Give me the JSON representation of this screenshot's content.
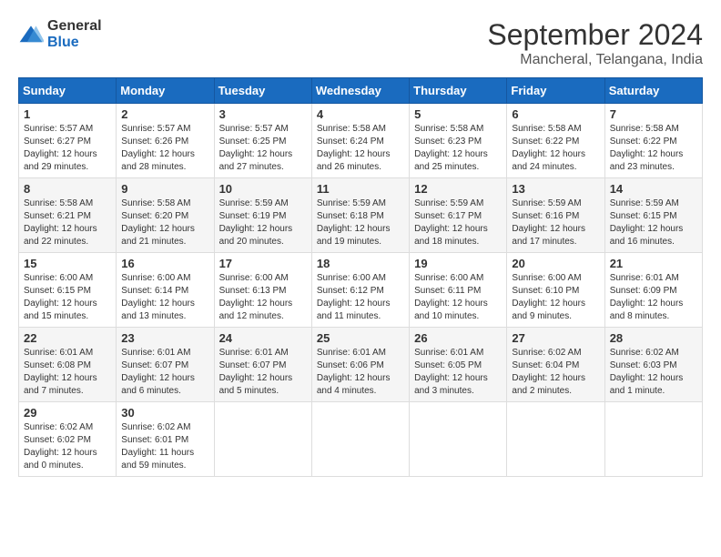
{
  "logo": {
    "general": "General",
    "blue": "Blue"
  },
  "title": "September 2024",
  "subtitle": "Mancheral, Telangana, India",
  "weekdays": [
    "Sunday",
    "Monday",
    "Tuesday",
    "Wednesday",
    "Thursday",
    "Friday",
    "Saturday"
  ],
  "weeks": [
    [
      {
        "day": "1",
        "sunrise": "5:57 AM",
        "sunset": "6:27 PM",
        "daylight": "12 hours and 29 minutes."
      },
      {
        "day": "2",
        "sunrise": "5:57 AM",
        "sunset": "6:26 PM",
        "daylight": "12 hours and 28 minutes."
      },
      {
        "day": "3",
        "sunrise": "5:57 AM",
        "sunset": "6:25 PM",
        "daylight": "12 hours and 27 minutes."
      },
      {
        "day": "4",
        "sunrise": "5:58 AM",
        "sunset": "6:24 PM",
        "daylight": "12 hours and 26 minutes."
      },
      {
        "day": "5",
        "sunrise": "5:58 AM",
        "sunset": "6:23 PM",
        "daylight": "12 hours and 25 minutes."
      },
      {
        "day": "6",
        "sunrise": "5:58 AM",
        "sunset": "6:22 PM",
        "daylight": "12 hours and 24 minutes."
      },
      {
        "day": "7",
        "sunrise": "5:58 AM",
        "sunset": "6:22 PM",
        "daylight": "12 hours and 23 minutes."
      }
    ],
    [
      {
        "day": "8",
        "sunrise": "5:58 AM",
        "sunset": "6:21 PM",
        "daylight": "12 hours and 22 minutes."
      },
      {
        "day": "9",
        "sunrise": "5:58 AM",
        "sunset": "6:20 PM",
        "daylight": "12 hours and 21 minutes."
      },
      {
        "day": "10",
        "sunrise": "5:59 AM",
        "sunset": "6:19 PM",
        "daylight": "12 hours and 20 minutes."
      },
      {
        "day": "11",
        "sunrise": "5:59 AM",
        "sunset": "6:18 PM",
        "daylight": "12 hours and 19 minutes."
      },
      {
        "day": "12",
        "sunrise": "5:59 AM",
        "sunset": "6:17 PM",
        "daylight": "12 hours and 18 minutes."
      },
      {
        "day": "13",
        "sunrise": "5:59 AM",
        "sunset": "6:16 PM",
        "daylight": "12 hours and 17 minutes."
      },
      {
        "day": "14",
        "sunrise": "5:59 AM",
        "sunset": "6:15 PM",
        "daylight": "12 hours and 16 minutes."
      }
    ],
    [
      {
        "day": "15",
        "sunrise": "6:00 AM",
        "sunset": "6:15 PM",
        "daylight": "12 hours and 15 minutes."
      },
      {
        "day": "16",
        "sunrise": "6:00 AM",
        "sunset": "6:14 PM",
        "daylight": "12 hours and 13 minutes."
      },
      {
        "day": "17",
        "sunrise": "6:00 AM",
        "sunset": "6:13 PM",
        "daylight": "12 hours and 12 minutes."
      },
      {
        "day": "18",
        "sunrise": "6:00 AM",
        "sunset": "6:12 PM",
        "daylight": "12 hours and 11 minutes."
      },
      {
        "day": "19",
        "sunrise": "6:00 AM",
        "sunset": "6:11 PM",
        "daylight": "12 hours and 10 minutes."
      },
      {
        "day": "20",
        "sunrise": "6:00 AM",
        "sunset": "6:10 PM",
        "daylight": "12 hours and 9 minutes."
      },
      {
        "day": "21",
        "sunrise": "6:01 AM",
        "sunset": "6:09 PM",
        "daylight": "12 hours and 8 minutes."
      }
    ],
    [
      {
        "day": "22",
        "sunrise": "6:01 AM",
        "sunset": "6:08 PM",
        "daylight": "12 hours and 7 minutes."
      },
      {
        "day": "23",
        "sunrise": "6:01 AM",
        "sunset": "6:07 PM",
        "daylight": "12 hours and 6 minutes."
      },
      {
        "day": "24",
        "sunrise": "6:01 AM",
        "sunset": "6:07 PM",
        "daylight": "12 hours and 5 minutes."
      },
      {
        "day": "25",
        "sunrise": "6:01 AM",
        "sunset": "6:06 PM",
        "daylight": "12 hours and 4 minutes."
      },
      {
        "day": "26",
        "sunrise": "6:01 AM",
        "sunset": "6:05 PM",
        "daylight": "12 hours and 3 minutes."
      },
      {
        "day": "27",
        "sunrise": "6:02 AM",
        "sunset": "6:04 PM",
        "daylight": "12 hours and 2 minutes."
      },
      {
        "day": "28",
        "sunrise": "6:02 AM",
        "sunset": "6:03 PM",
        "daylight": "12 hours and 1 minute."
      }
    ],
    [
      {
        "day": "29",
        "sunrise": "6:02 AM",
        "sunset": "6:02 PM",
        "daylight": "12 hours and 0 minutes."
      },
      {
        "day": "30",
        "sunrise": "6:02 AM",
        "sunset": "6:01 PM",
        "daylight": "11 hours and 59 minutes."
      },
      null,
      null,
      null,
      null,
      null
    ]
  ],
  "labels": {
    "sunrise": "Sunrise:",
    "sunset": "Sunset:",
    "daylight": "Daylight:"
  }
}
